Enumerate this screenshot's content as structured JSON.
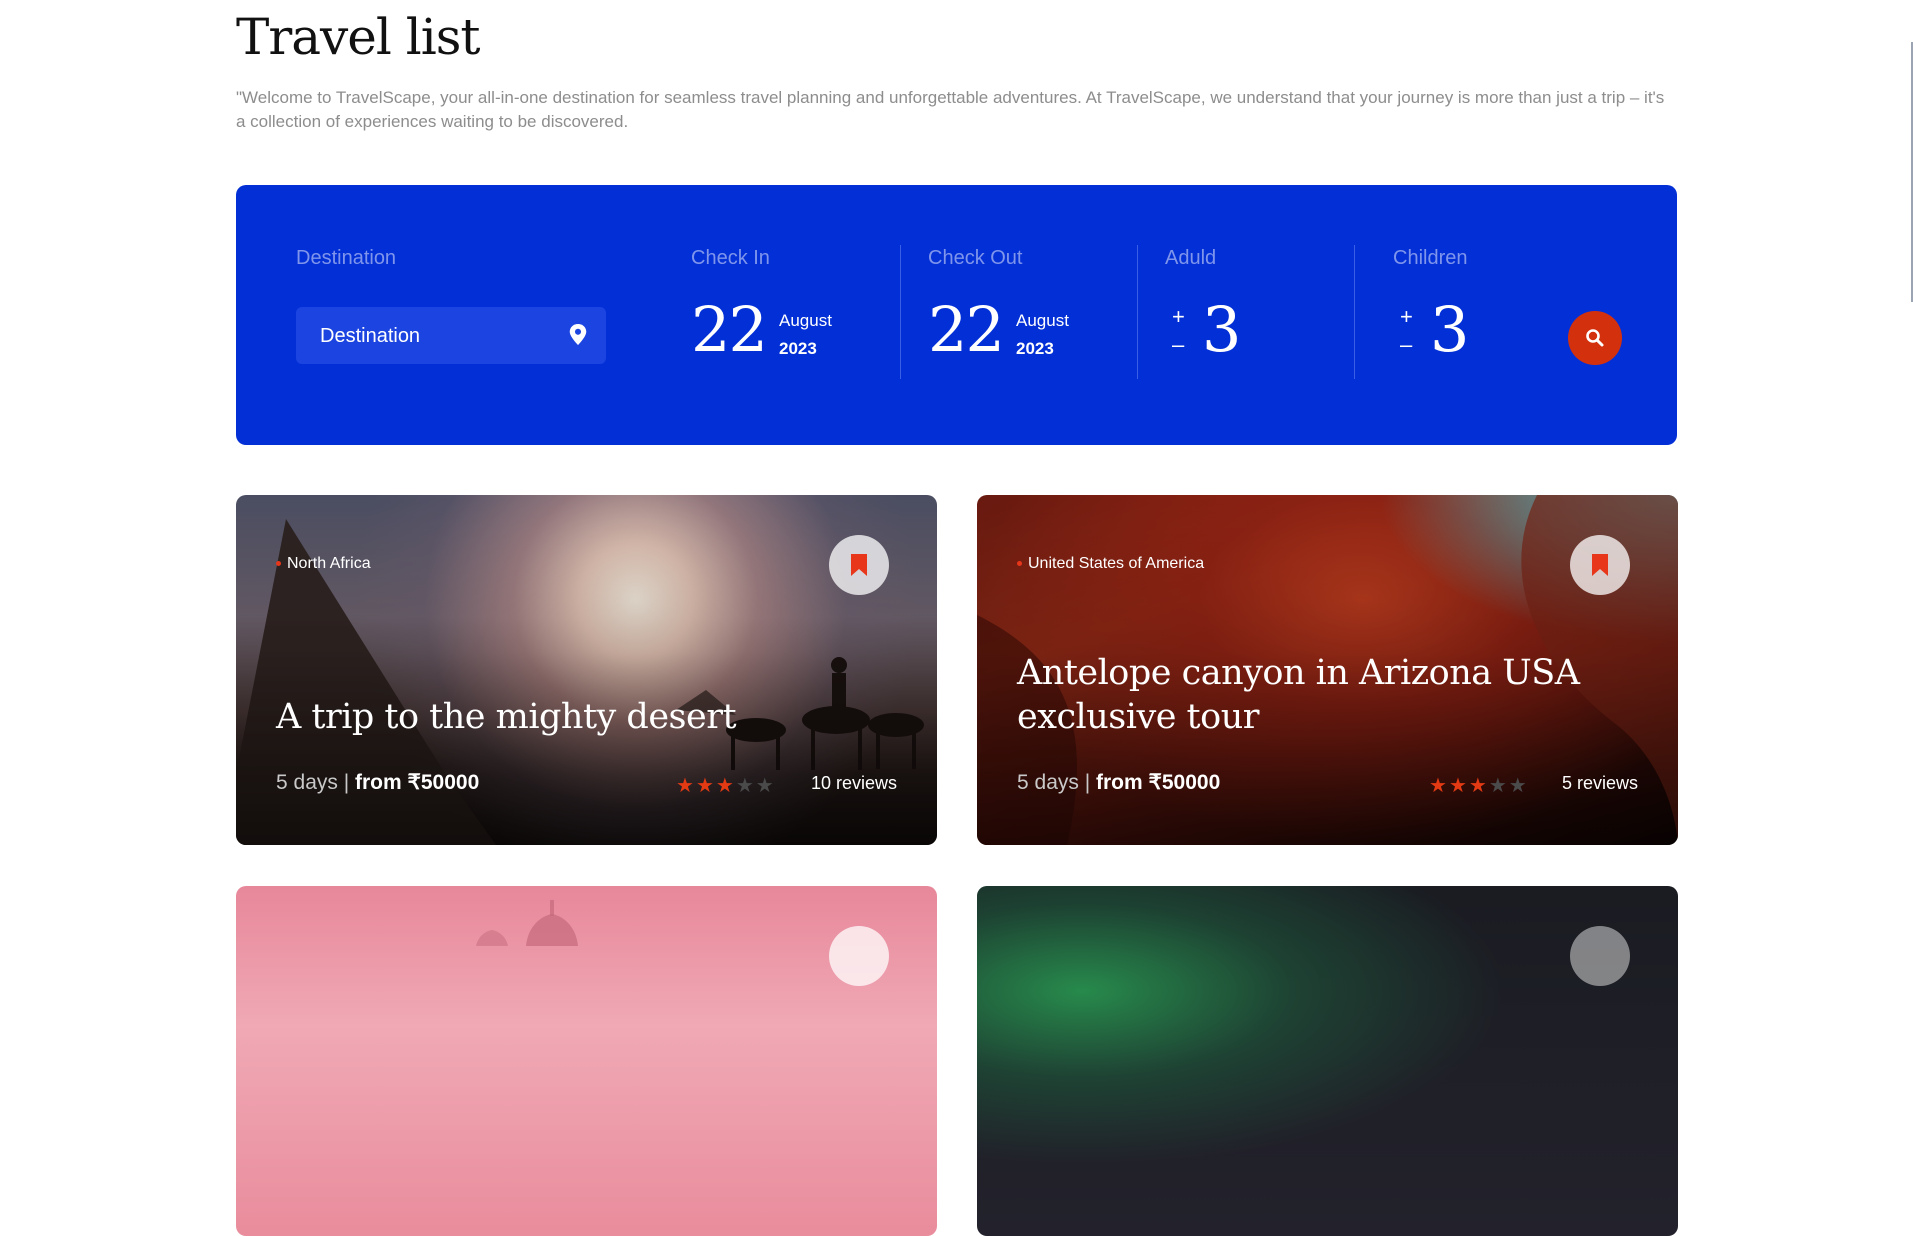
{
  "page": {
    "title": "Travel list",
    "intro": "\"Welcome to TravelScape, your all-in-one destination for seamless travel planning and unforgettable adventures. At TravelScape, we understand that your journey is more than just a trip – it's a collection of experiences waiting to be discovered."
  },
  "search": {
    "destination_label": "Destination",
    "destination_value": "Destination",
    "check_in_label": "Check In",
    "check_in_day": "22",
    "check_in_month": "August",
    "check_in_year": "2023",
    "check_out_label": "Check Out",
    "check_out_day": "22",
    "check_out_month": "August",
    "check_out_year": "2023",
    "adult_label": "Aduld",
    "adult_count": "3",
    "children_label": "Children",
    "children_count": "3",
    "plus": "+",
    "minus": "–",
    "accent_color": "#0330d6",
    "button_color": "#d3310e"
  },
  "cards": [
    {
      "region": "North Africa",
      "title": "A trip to the mighty desert",
      "duration": "5 days |",
      "price": "from ₹50000",
      "rating": 3,
      "rating_max": 5,
      "reviews": "10 reviews"
    },
    {
      "region": "United States of America",
      "title": "Antelope canyon in Arizona USA exclusive tour",
      "duration": "5 days |",
      "price": "from ₹50000",
      "rating": 3,
      "rating_max": 5,
      "reviews": "5 reviews"
    }
  ]
}
